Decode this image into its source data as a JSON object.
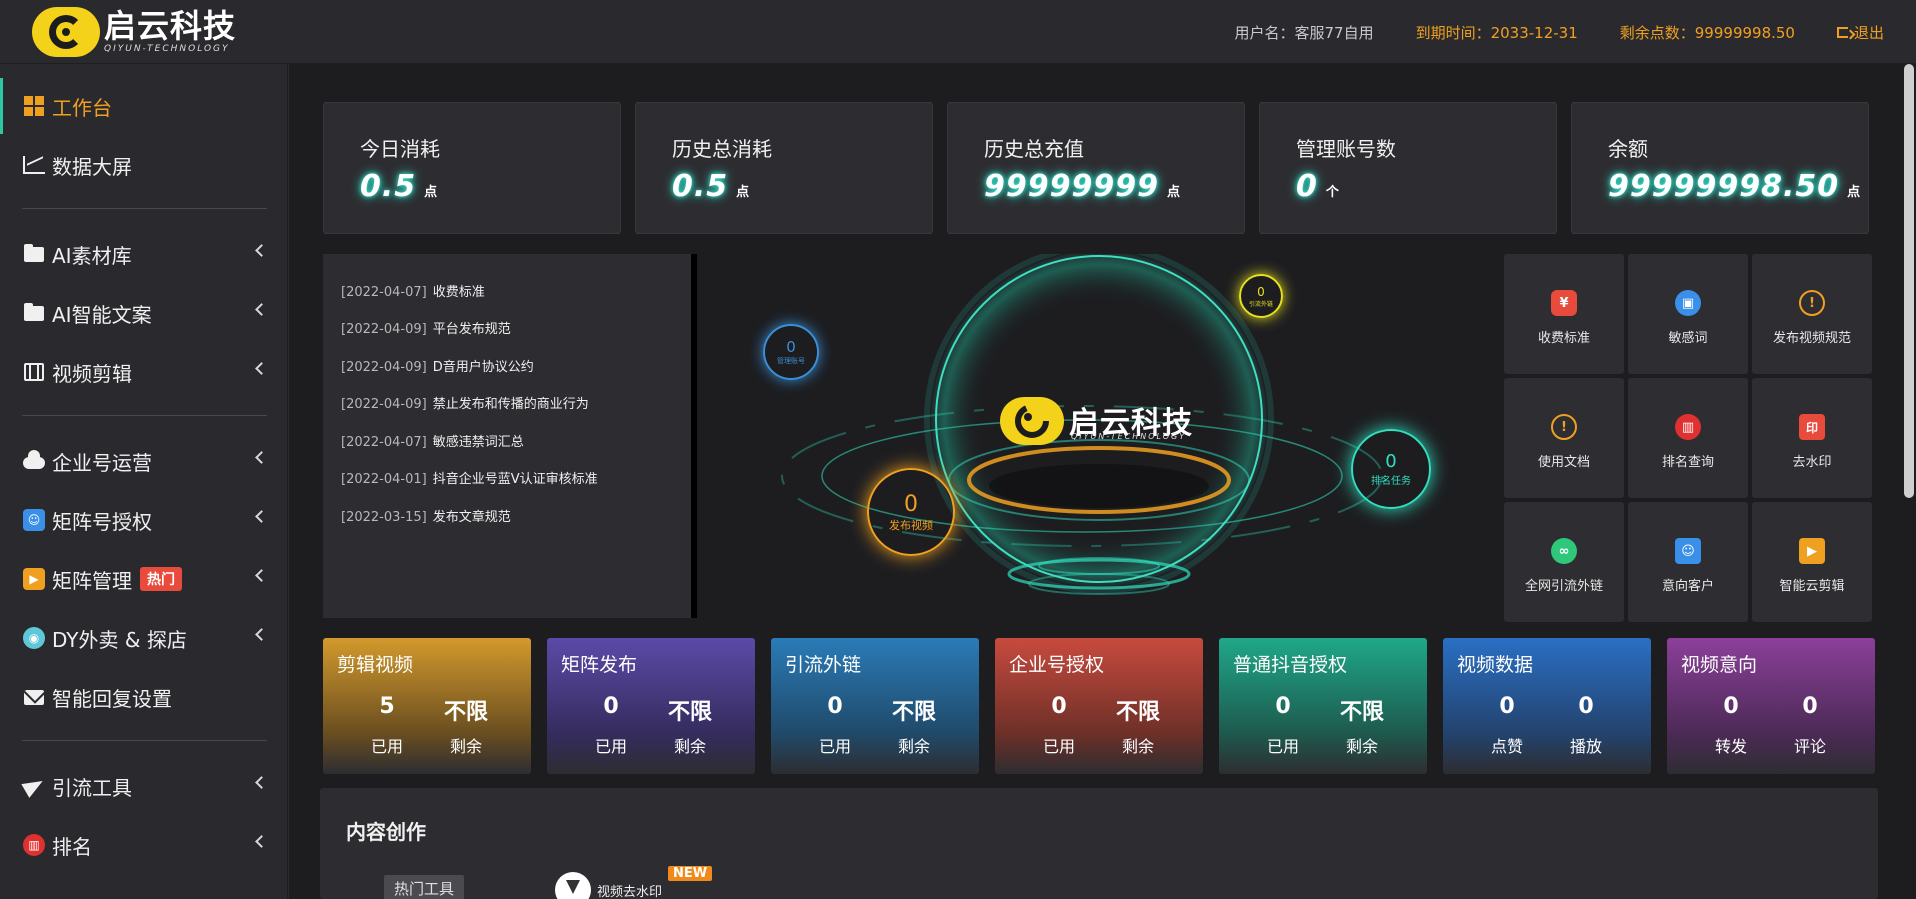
{
  "header": {
    "logo_cn": "启云科技",
    "logo_en": "QIYUN-TECHNOLOGY",
    "username": "用户名：客服77自用",
    "expiry": "到期时间：2033-12-31",
    "points": "剩余点数：99999998.50",
    "logout": "退出"
  },
  "sidebar": {
    "items": [
      {
        "label": "工作台"
      },
      {
        "label": "数据大屏"
      },
      {
        "label": "AI素材库"
      },
      {
        "label": "AI智能文案"
      },
      {
        "label": "视频剪辑"
      },
      {
        "label": "企业号运营"
      },
      {
        "label": "矩阵号授权"
      },
      {
        "label": "矩阵管理",
        "badge": "热门"
      },
      {
        "label": "DY外卖 & 探店"
      },
      {
        "label": "智能回复设置"
      },
      {
        "label": "引流工具"
      },
      {
        "label": "排名"
      }
    ]
  },
  "stats": [
    {
      "label": "今日消耗",
      "value": "0.5",
      "unit": "点"
    },
    {
      "label": "历史总消耗",
      "value": "0.5",
      "unit": "点"
    },
    {
      "label": "历史总充值",
      "value": "99999999",
      "unit": "点"
    },
    {
      "label": "管理账号数",
      "value": "0",
      "unit": "个"
    },
    {
      "label": "余额",
      "value": "99999998.50",
      "unit": "点"
    }
  ],
  "notices": [
    {
      "date": "[2022-04-07]",
      "title": "收费标准"
    },
    {
      "date": "[2022-04-09]",
      "title": "平台发布规范"
    },
    {
      "date": "[2022-04-09]",
      "title": "D音用户协议公约"
    },
    {
      "date": "[2022-04-09]",
      "title": "禁止发布和传播的商业行为"
    },
    {
      "date": "[2022-04-07]",
      "title": "敏感违禁词汇总"
    },
    {
      "date": "[2022-04-01]",
      "title": "抖音企业号蓝V认证审核标准"
    },
    {
      "date": "[2022-03-15]",
      "title": "发布文章规范"
    }
  ],
  "hero": {
    "logo_cn": "启云科技",
    "logo_en": "QIYUN-TECHNOLOGY",
    "orbs": [
      {
        "value": "0",
        "label": "管理账号",
        "color": "#3a8fd8"
      },
      {
        "value": "0",
        "label": "引流外链",
        "color": "#e6e020"
      },
      {
        "value": "0",
        "label": "发布视频",
        "color": "#f0a020"
      },
      {
        "value": "0",
        "label": "排名任务",
        "color": "#30e0c0"
      }
    ]
  },
  "tiles": [
    {
      "label": "收费标准",
      "icon": "yen-icon",
      "color": "#e84a3c",
      "glyph": "¥"
    },
    {
      "label": "敏感词",
      "icon": "briefcase-icon",
      "color": "#3a8fe8",
      "glyph": "▣"
    },
    {
      "label": "发布视频规范",
      "icon": "warning-icon",
      "color": "#f0a020",
      "glyph": "!"
    },
    {
      "label": "使用文档",
      "icon": "warning-icon",
      "color": "#f0a020",
      "glyph": "!"
    },
    {
      "label": "排名查询",
      "icon": "bar-chart-icon",
      "color": "#e03030",
      "glyph": "▥"
    },
    {
      "label": "去水印",
      "icon": "seal-icon",
      "color": "#e84a3c",
      "glyph": "印"
    },
    {
      "label": "全网引流外链",
      "icon": "link-icon",
      "color": "#2fc77a",
      "glyph": "∞"
    },
    {
      "label": "意向客户",
      "icon": "contact-icon",
      "color": "#3a8fe8",
      "glyph": "☺"
    },
    {
      "label": "智能云剪辑",
      "icon": "video-icon",
      "color": "#f0a020",
      "glyph": "▶"
    }
  ],
  "quotas": [
    {
      "title": "剪辑视频",
      "v1": "5",
      "l1": "已用",
      "v2": "不限",
      "l2": "剩余",
      "color": "#d39a2c"
    },
    {
      "title": "矩阵发布",
      "v1": "0",
      "l1": "已用",
      "v2": "不限",
      "l2": "剩余",
      "color": "#5c4aa8"
    },
    {
      "title": "引流外链",
      "v1": "0",
      "l1": "已用",
      "v2": "不限",
      "l2": "剩余",
      "color": "#2a7bb8"
    },
    {
      "title": "企业号授权",
      "v1": "0",
      "l1": "已用",
      "v2": "不限",
      "l2": "剩余",
      "color": "#c84a3e"
    },
    {
      "title": "普通抖音授权",
      "v1": "0",
      "l1": "已用",
      "v2": "不限",
      "l2": "剩余",
      "color": "#1fa889"
    },
    {
      "title": "视频数据",
      "v1": "0",
      "l1": "点赞",
      "v2": "0",
      "l2": "播放",
      "color": "#2a6fc4"
    },
    {
      "title": "视频意向",
      "v1": "0",
      "l1": "转发",
      "v2": "0",
      "l2": "评论",
      "color": "#8c3f9a"
    }
  ],
  "creation": {
    "title": "内容创作",
    "hot_tools": "热门工具",
    "tool_label": "视频去水印",
    "new_badge": "NEW"
  }
}
